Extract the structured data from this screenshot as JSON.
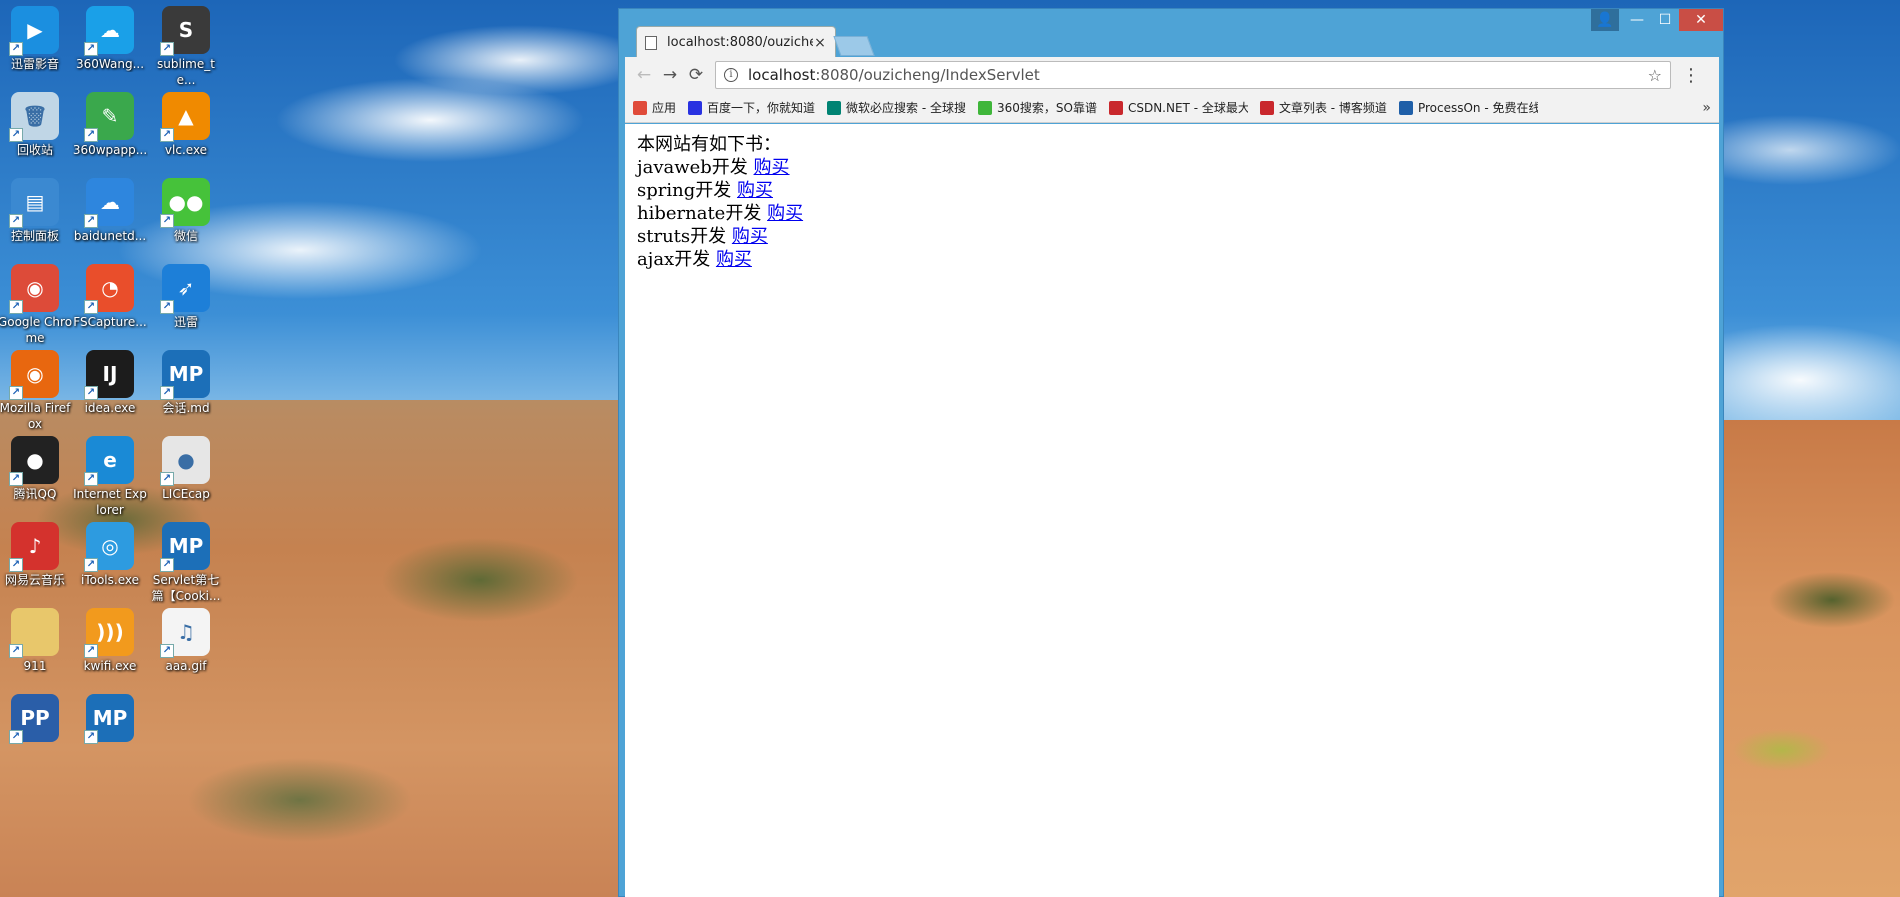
{
  "desktop": {
    "icons": [
      {
        "name": "xunlei-player",
        "label": "迅雷影音",
        "icon": "play-circle-icon",
        "color": "#1b8fe0"
      },
      {
        "name": "360wangpan",
        "label": "360Wang...",
        "icon": "cloud-icon",
        "color": "#1aa0e8"
      },
      {
        "name": "sublime",
        "label": "sublime_te...",
        "icon": "sublime-icon",
        "color": "#3a3a3a"
      },
      {
        "name": "recycle-bin",
        "label": "回收站",
        "icon": "trash-icon",
        "color": "#c0d6e6"
      },
      {
        "name": "360wpapp",
        "label": "360wpapp...",
        "icon": "leaf-icon",
        "color": "#3aa84c"
      },
      {
        "name": "vlc",
        "label": "vlc.exe",
        "icon": "cone-icon",
        "color": "#f08a00"
      },
      {
        "name": "control-panel",
        "label": "控制面板",
        "icon": "panel-icon",
        "color": "#3b89d1"
      },
      {
        "name": "baidunetdisk",
        "label": "baidunetd...",
        "icon": "baidu-cloud-icon",
        "color": "#2e86de"
      },
      {
        "name": "wechat",
        "label": "微信",
        "icon": "wechat-icon",
        "color": "#46c23a"
      },
      {
        "name": "chrome",
        "label": "Google Chrome",
        "icon": "chrome-icon",
        "color": "#dd4b39"
      },
      {
        "name": "fscapture",
        "label": "FSCapture...",
        "icon": "fscapture-icon",
        "color": "#e94e2b"
      },
      {
        "name": "xunlei",
        "label": "迅雷",
        "icon": "bird-icon",
        "color": "#1d7fd8"
      },
      {
        "name": "firefox",
        "label": "Mozilla Firefox",
        "icon": "firefox-icon",
        "color": "#e8670f"
      },
      {
        "name": "idea",
        "label": "idea.exe",
        "icon": "intellij-icon",
        "color": "#1c1c1c"
      },
      {
        "name": "huihua-md",
        "label": "会话.md",
        "icon": "markdown-icon",
        "color": "#1c6fb8"
      },
      {
        "name": "qq",
        "label": "腾讯QQ",
        "icon": "penguin-icon",
        "color": "#222222"
      },
      {
        "name": "ie",
        "label": "Internet Explorer",
        "icon": "ie-icon",
        "color": "#1a8ad6"
      },
      {
        "name": "licecap",
        "label": "LICEcap",
        "icon": "record-icon",
        "color": "#e6e6e6"
      },
      {
        "name": "netease-music",
        "label": "网易云音乐",
        "icon": "music-icon",
        "color": "#d4322d"
      },
      {
        "name": "itools",
        "label": "iTools.exe",
        "icon": "itools-icon",
        "color": "#2d9be0"
      },
      {
        "name": "servlet-md",
        "label": "Servlet第七篇【Cooki...",
        "icon": "markdown-icon",
        "color": "#1c6fb8"
      },
      {
        "name": "folder-911",
        "label": "911",
        "icon": "folder-icon",
        "color": "#e8c76b"
      },
      {
        "name": "kwifi",
        "label": "kwifi.exe",
        "icon": "wifi-icon",
        "color": "#f29a1d"
      },
      {
        "name": "aaa-gif",
        "label": "aaa.gif",
        "icon": "image-file-icon",
        "color": "#f4f4f4"
      },
      {
        "name": "pp-file",
        "label": "",
        "icon": "pp-icon",
        "color": "#2a5ea8"
      },
      {
        "name": "mp-file",
        "label": "",
        "icon": "markdown-icon",
        "color": "#1c6fb8"
      }
    ]
  },
  "browser": {
    "tab": {
      "title": "localhost:8080/ouziche",
      "close": "×"
    },
    "controls": {
      "user": "👤",
      "minimize": "—",
      "maximize": "☐",
      "close": "✕"
    },
    "nav": {
      "back": "←",
      "forward": "→",
      "reload": "⟳"
    },
    "address": {
      "host": "localhost",
      "rest": ":8080/ouzicheng/IndexServlet",
      "info": "i",
      "star": "☆"
    },
    "menu": "⋮",
    "bookmarks": [
      {
        "label": "应用",
        "color": "#e04b3a",
        "icon": "apps-icon"
      },
      {
        "label": "百度一下，你就知道",
        "color": "#2932e1",
        "icon": "baidu-icon"
      },
      {
        "label": "微软必应搜索 - 全球搜",
        "color": "#008373",
        "icon": "bing-icon"
      },
      {
        "label": "360搜索，SO靠谱",
        "color": "#3fb63a",
        "icon": "so360-icon"
      },
      {
        "label": "CSDN.NET - 全球最大",
        "color": "#c9282d",
        "icon": "csdn-icon"
      },
      {
        "label": "文章列表 - 博客频道",
        "color": "#c9282d",
        "icon": "csdn-icon"
      },
      {
        "label": "ProcessOn - 免费在线",
        "color": "#1f5fa8",
        "icon": "processon-icon"
      }
    ],
    "bookmarks_more": "»"
  },
  "page": {
    "heading": "本网站有如下书：",
    "books": [
      {
        "title": "javaweb开发",
        "link": "购买"
      },
      {
        "title": "spring开发",
        "link": "购买"
      },
      {
        "title": "hibernate开发",
        "link": "购买"
      },
      {
        "title": "struts开发",
        "link": "购买"
      },
      {
        "title": "ajax开发",
        "link": "购买"
      }
    ]
  }
}
